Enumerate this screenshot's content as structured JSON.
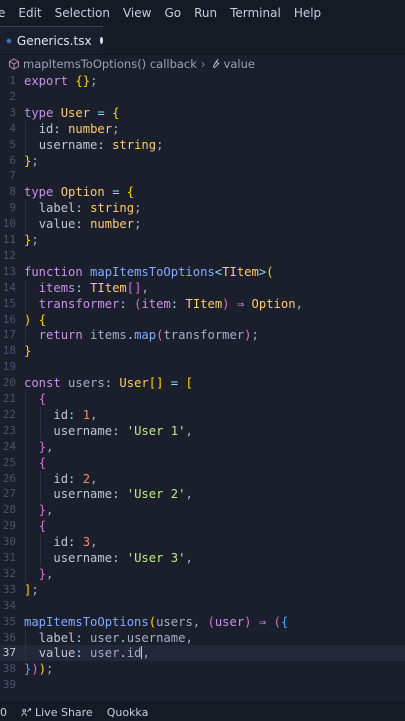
{
  "menubar": [
    "e",
    "Edit",
    "Selection",
    "View",
    "Go",
    "Run",
    "Terminal",
    "Help"
  ],
  "tab": {
    "filename": "Generics.tsx",
    "icon": "react-tsx-icon",
    "modified": true
  },
  "breadcrumb": {
    "function": "mapItemsToOptions() callback",
    "property": "value"
  },
  "editor": {
    "current_line": 37,
    "lines": [
      {
        "n": 1,
        "tokens": [
          [
            "k",
            "export"
          ],
          [
            "v",
            " "
          ],
          [
            "br1",
            "{"
          ],
          [
            "br1",
            "}"
          ],
          [
            "v",
            ";"
          ]
        ]
      },
      {
        "n": 2,
        "tokens": []
      },
      {
        "n": 3,
        "tokens": [
          [
            "k",
            "type"
          ],
          [
            "v",
            " "
          ],
          [
            "t",
            "User"
          ],
          [
            "v",
            " "
          ],
          [
            "p",
            "="
          ],
          [
            "v",
            " "
          ],
          [
            "br1",
            "{"
          ]
        ]
      },
      {
        "n": 4,
        "tokens": [
          [
            "v",
            "  "
          ],
          [
            "pr",
            "id"
          ],
          [
            "p",
            ":"
          ],
          [
            "v",
            " "
          ],
          [
            "t",
            "number"
          ],
          [
            "v",
            ";"
          ]
        ]
      },
      {
        "n": 5,
        "tokens": [
          [
            "v",
            "  "
          ],
          [
            "pr",
            "username"
          ],
          [
            "p",
            ":"
          ],
          [
            "v",
            " "
          ],
          [
            "t",
            "string"
          ],
          [
            "v",
            ";"
          ]
        ]
      },
      {
        "n": 6,
        "tokens": [
          [
            "br1",
            "}"
          ],
          [
            "v",
            ";"
          ]
        ]
      },
      {
        "n": 7,
        "tokens": []
      },
      {
        "n": 8,
        "tokens": [
          [
            "k",
            "type"
          ],
          [
            "v",
            " "
          ],
          [
            "t",
            "Option"
          ],
          [
            "v",
            " "
          ],
          [
            "p",
            "="
          ],
          [
            "v",
            " "
          ],
          [
            "br1",
            "{"
          ]
        ]
      },
      {
        "n": 9,
        "tokens": [
          [
            "v",
            "  "
          ],
          [
            "pr",
            "label"
          ],
          [
            "p",
            ":"
          ],
          [
            "v",
            " "
          ],
          [
            "t",
            "string"
          ],
          [
            "v",
            ";"
          ]
        ]
      },
      {
        "n": 10,
        "tokens": [
          [
            "v",
            "  "
          ],
          [
            "pr",
            "value"
          ],
          [
            "p",
            ":"
          ],
          [
            "v",
            " "
          ],
          [
            "t",
            "number"
          ],
          [
            "v",
            ";"
          ]
        ]
      },
      {
        "n": 11,
        "tokens": [
          [
            "br1",
            "}"
          ],
          [
            "v",
            ";"
          ]
        ]
      },
      {
        "n": 12,
        "tokens": []
      },
      {
        "n": 13,
        "tokens": [
          [
            "k",
            "function"
          ],
          [
            "v",
            " "
          ],
          [
            "f",
            "mapItemsToOptions"
          ],
          [
            "p",
            "<"
          ],
          [
            "t",
            "TItem"
          ],
          [
            "p",
            ">"
          ],
          [
            "br1",
            "("
          ]
        ]
      },
      {
        "n": 14,
        "tokens": [
          [
            "v",
            "  "
          ],
          [
            "k",
            "items"
          ],
          [
            "p",
            ":"
          ],
          [
            "v",
            " "
          ],
          [
            "t",
            "TItem"
          ],
          [
            "br2",
            "[]"
          ],
          [
            "v",
            ","
          ]
        ]
      },
      {
        "n": 15,
        "tokens": [
          [
            "v",
            "  "
          ],
          [
            "k",
            "transformer"
          ],
          [
            "p",
            ":"
          ],
          [
            "v",
            " "
          ],
          [
            "br2",
            "("
          ],
          [
            "k",
            "item"
          ],
          [
            "p",
            ":"
          ],
          [
            "v",
            " "
          ],
          [
            "t",
            "TItem"
          ],
          [
            "br2",
            ")"
          ],
          [
            "v",
            " "
          ],
          [
            "k",
            "⇒"
          ],
          [
            "v",
            " "
          ],
          [
            "t",
            "Option"
          ],
          [
            "v",
            ","
          ]
        ]
      },
      {
        "n": 16,
        "tokens": [
          [
            "br1",
            ")"
          ],
          [
            "v",
            " "
          ],
          [
            "br1",
            "{"
          ]
        ]
      },
      {
        "n": 17,
        "tokens": [
          [
            "v",
            "  "
          ],
          [
            "k",
            "return"
          ],
          [
            "v",
            " items"
          ],
          [
            "p",
            "."
          ],
          [
            "f",
            "map"
          ],
          [
            "br2",
            "("
          ],
          [
            "v",
            "transformer"
          ],
          [
            "br2",
            ")"
          ],
          [
            "v",
            ";"
          ]
        ]
      },
      {
        "n": 18,
        "tokens": [
          [
            "br1",
            "}"
          ]
        ]
      },
      {
        "n": 19,
        "tokens": []
      },
      {
        "n": 20,
        "tokens": [
          [
            "k",
            "const"
          ],
          [
            "v",
            " users"
          ],
          [
            "p",
            ":"
          ],
          [
            "v",
            " "
          ],
          [
            "t",
            "User"
          ],
          [
            "br1",
            "[]"
          ],
          [
            "v",
            " "
          ],
          [
            "p",
            "="
          ],
          [
            "v",
            " "
          ],
          [
            "br1",
            "["
          ]
        ]
      },
      {
        "n": 21,
        "tokens": [
          [
            "v",
            "  "
          ],
          [
            "br2",
            "{"
          ]
        ]
      },
      {
        "n": 22,
        "tokens": [
          [
            "v",
            "    "
          ],
          [
            "pr",
            "id"
          ],
          [
            "p",
            ":"
          ],
          [
            "v",
            " "
          ],
          [
            "n",
            "1"
          ],
          [
            "v",
            ","
          ]
        ]
      },
      {
        "n": 23,
        "tokens": [
          [
            "v",
            "    "
          ],
          [
            "pr",
            "username"
          ],
          [
            "p",
            ":"
          ],
          [
            "v",
            " "
          ],
          [
            "s",
            "'User 1'"
          ],
          [
            "v",
            ","
          ]
        ]
      },
      {
        "n": 24,
        "tokens": [
          [
            "v",
            "  "
          ],
          [
            "br2",
            "}"
          ],
          [
            "v",
            ","
          ]
        ]
      },
      {
        "n": 25,
        "tokens": [
          [
            "v",
            "  "
          ],
          [
            "br2",
            "{"
          ]
        ]
      },
      {
        "n": 26,
        "tokens": [
          [
            "v",
            "    "
          ],
          [
            "pr",
            "id"
          ],
          [
            "p",
            ":"
          ],
          [
            "v",
            " "
          ],
          [
            "n",
            "2"
          ],
          [
            "v",
            ","
          ]
        ]
      },
      {
        "n": 27,
        "tokens": [
          [
            "v",
            "    "
          ],
          [
            "pr",
            "username"
          ],
          [
            "p",
            ":"
          ],
          [
            "v",
            " "
          ],
          [
            "s",
            "'User 2'"
          ],
          [
            "v",
            ","
          ]
        ]
      },
      {
        "n": 28,
        "tokens": [
          [
            "v",
            "  "
          ],
          [
            "br2",
            "}"
          ],
          [
            "v",
            ","
          ]
        ]
      },
      {
        "n": 29,
        "tokens": [
          [
            "v",
            "  "
          ],
          [
            "br2",
            "{"
          ]
        ]
      },
      {
        "n": 30,
        "tokens": [
          [
            "v",
            "    "
          ],
          [
            "pr",
            "id"
          ],
          [
            "p",
            ":"
          ],
          [
            "v",
            " "
          ],
          [
            "n",
            "3"
          ],
          [
            "v",
            ","
          ]
        ]
      },
      {
        "n": 31,
        "tokens": [
          [
            "v",
            "    "
          ],
          [
            "pr",
            "username"
          ],
          [
            "p",
            ":"
          ],
          [
            "v",
            " "
          ],
          [
            "s",
            "'User 3'"
          ],
          [
            "v",
            ","
          ]
        ]
      },
      {
        "n": 32,
        "tokens": [
          [
            "v",
            "  "
          ],
          [
            "br2",
            "}"
          ],
          [
            "v",
            ","
          ]
        ]
      },
      {
        "n": 33,
        "tokens": [
          [
            "br1",
            "]"
          ],
          [
            "v",
            ";"
          ]
        ]
      },
      {
        "n": 34,
        "tokens": []
      },
      {
        "n": 35,
        "tokens": [
          [
            "f",
            "mapItemsToOptions"
          ],
          [
            "br1",
            "("
          ],
          [
            "v",
            "users, "
          ],
          [
            "br2",
            "("
          ],
          [
            "k",
            "user"
          ],
          [
            "br2",
            ")"
          ],
          [
            "v",
            " "
          ],
          [
            "k",
            "⇒"
          ],
          [
            "v",
            " "
          ],
          [
            "br2",
            "("
          ],
          [
            "br3",
            "{"
          ]
        ]
      },
      {
        "n": 36,
        "tokens": [
          [
            "v",
            "  "
          ],
          [
            "pr",
            "label"
          ],
          [
            "p",
            ":"
          ],
          [
            "v",
            " user"
          ],
          [
            "p",
            "."
          ],
          [
            "v",
            "username,"
          ]
        ]
      },
      {
        "n": 37,
        "tokens": [
          [
            "v",
            "  "
          ],
          [
            "pr",
            "value"
          ],
          [
            "p",
            ":"
          ],
          [
            "v",
            " user"
          ],
          [
            "p",
            "."
          ],
          [
            "v",
            "id"
          ],
          [
            "cursor",
            ""
          ],
          [
            "v",
            ","
          ]
        ]
      },
      {
        "n": 38,
        "tokens": [
          [
            "br3",
            "}"
          ],
          [
            "br2",
            ")"
          ],
          [
            "br1",
            ")"
          ],
          [
            "v",
            ";"
          ]
        ]
      },
      {
        "n": 39,
        "tokens": []
      }
    ]
  },
  "statusbar": {
    "left": "0",
    "live_share": "Live Share",
    "quokka": "Quokka"
  }
}
